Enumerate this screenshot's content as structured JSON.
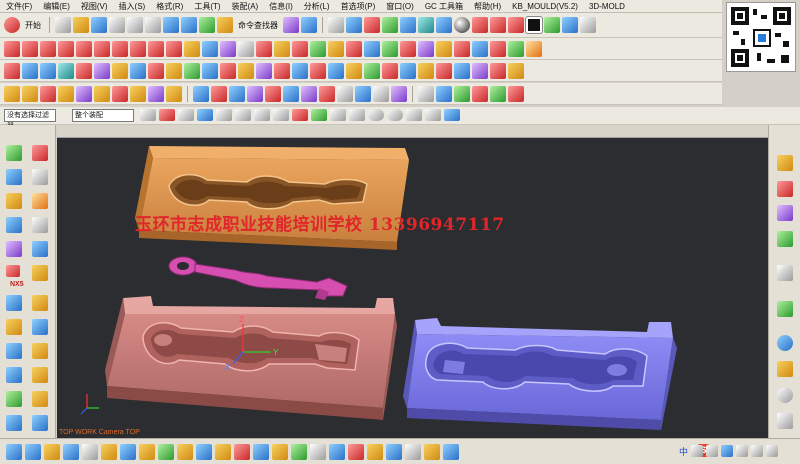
{
  "menu": [
    "文件(F)",
    "编辑(E)",
    "视图(V)",
    "插入(S)",
    "格式(R)",
    "工具(T)",
    "装配(A)",
    "信息(I)",
    "分析(L)",
    "首选项(P)",
    "窗口(O)",
    "GC 工具箱",
    "帮助(H)",
    "KB_MOULD(V5.2)",
    "3D-MOLD"
  ],
  "toolbar": {
    "start_label": "开始",
    "command_finder_label": "命令查找器"
  },
  "selection": {
    "filter_value": "没有选择过滤器",
    "assembly_value": "整个装配"
  },
  "sidebar": {
    "nx5_label": "NX5"
  },
  "viewport": {
    "watermark": "玉环市志成职业技能培训学校  13396947117",
    "view_label": "TOP WORK Camera TOP",
    "axis_labels": {
      "x": "X",
      "y": "Y",
      "z": "Z"
    },
    "colors": {
      "background": "#2b2d31",
      "upper_mold": "#e09a55",
      "part": "#d64fb0",
      "core_block": "#c97d78",
      "cavity_block": "#7f7df0"
    }
  },
  "statusbar": {
    "ime_label": "S",
    "ime_mode": "中"
  }
}
